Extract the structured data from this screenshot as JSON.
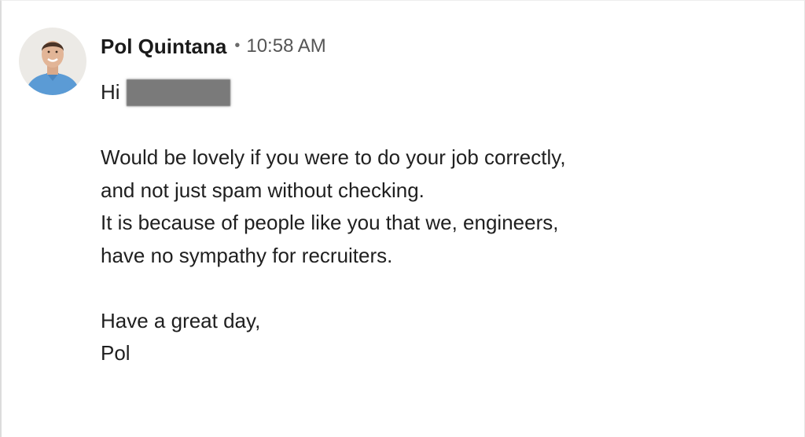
{
  "message": {
    "sender": {
      "name": "Pol Quintana",
      "separator": "•",
      "time": "10:58 AM"
    },
    "greeting_word": "Hi",
    "paragraph_1": [
      "Would be lovely if you were to do your job correctly,",
      "and not just spam without checking.",
      "It is because of people like you that we, engineers,",
      "have no sympathy for recruiters."
    ],
    "closing": "Have a great day,",
    "signature": "Pol"
  },
  "colors": {
    "text": "#1f1f1f",
    "timestamp": "#555555",
    "redaction": "#7a7a7a",
    "avatar_shirt": "#5b9bd5"
  }
}
